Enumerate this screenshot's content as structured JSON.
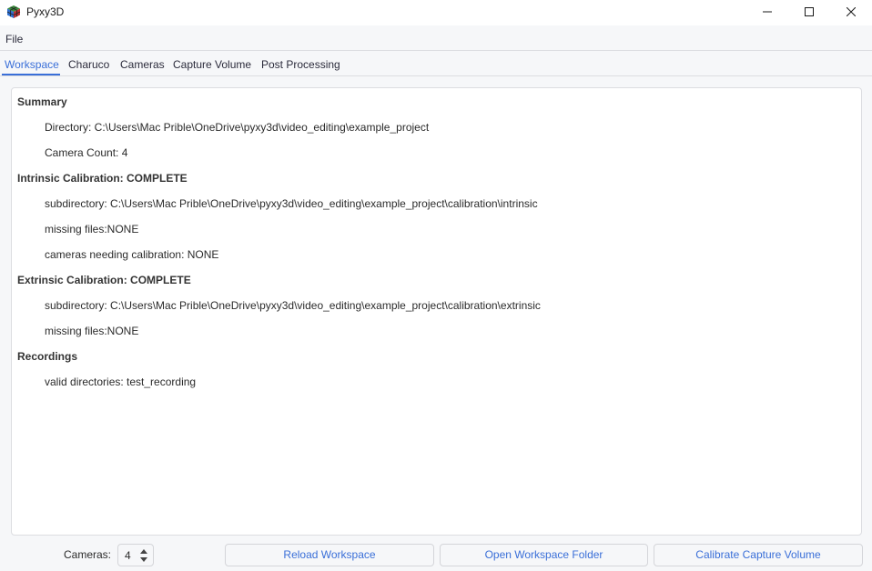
{
  "window": {
    "title": "Pyxy3D",
    "icon": "cube-logo-icon",
    "controls": {
      "minimize": "minimize-icon",
      "maximize": "maximize-icon",
      "close": "close-icon"
    }
  },
  "menubar": {
    "items": [
      {
        "label": "File"
      }
    ]
  },
  "tabs": [
    {
      "label": "Workspace",
      "active": true
    },
    {
      "label": "Charuco",
      "active": false
    },
    {
      "label": "Cameras",
      "active": false
    },
    {
      "label": "Capture Volume",
      "active": false
    },
    {
      "label": "Post Processing",
      "active": false
    }
  ],
  "summary": {
    "sections": [
      {
        "heading": "Summary",
        "items": [
          "Directory: C:\\Users\\Mac Prible\\OneDrive\\pyxy3d\\video_editing\\example_project",
          "Camera Count: 4"
        ]
      },
      {
        "heading": "Intrinsic Calibration: COMPLETE",
        "items": [
          "subdirectory: C:\\Users\\Mac Prible\\OneDrive\\pyxy3d\\video_editing\\example_project\\calibration\\intrinsic",
          "missing files:NONE",
          "cameras needing calibration: NONE"
        ]
      },
      {
        "heading": "Extrinsic Calibration: COMPLETE",
        "items": [
          "subdirectory: C:\\Users\\Mac Prible\\OneDrive\\pyxy3d\\video_editing\\example_project\\calibration\\extrinsic",
          "missing files:NONE"
        ]
      },
      {
        "heading": "Recordings",
        "items": [
          "valid directories: test_recording"
        ]
      }
    ]
  },
  "bottom": {
    "cameras_label": "Cameras:",
    "cameras_value": "4",
    "buttons": {
      "reload": "Reload Workspace",
      "open_folder": "Open Workspace Folder",
      "calibrate": "Calibrate Capture Volume"
    }
  },
  "colors": {
    "accent": "#3a6fd8",
    "background": "#f6f7f9",
    "panel": "#ffffff",
    "border": "#dcdde1"
  }
}
